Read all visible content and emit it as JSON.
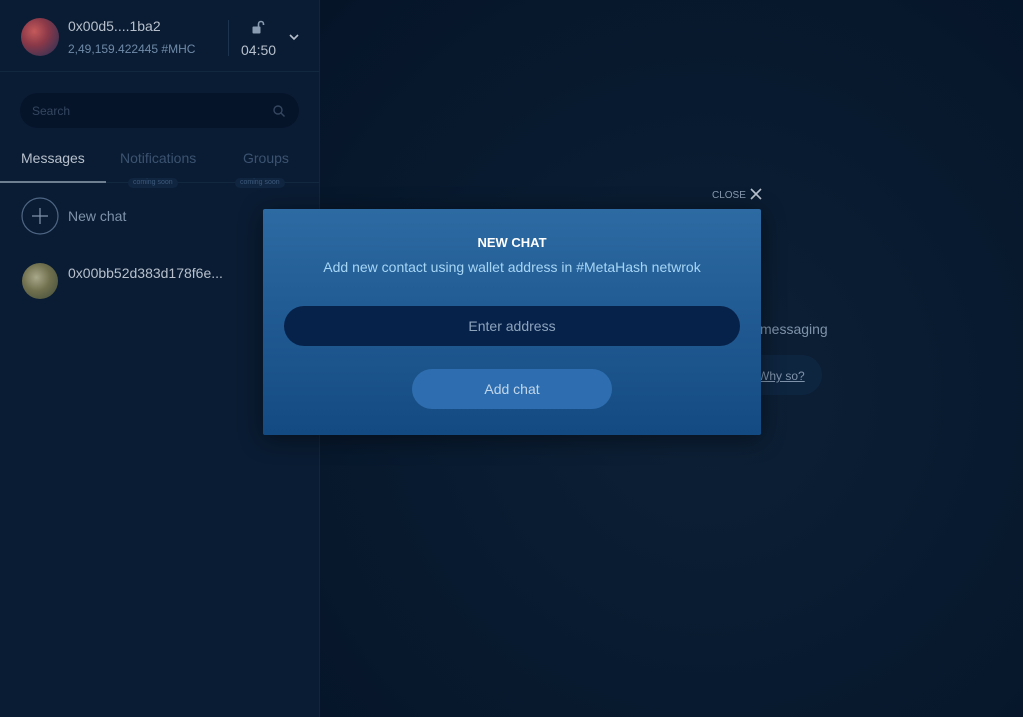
{
  "profile": {
    "address": "0x00d5....1ba2",
    "balance": "2,49,159.422445 #MHC",
    "time": "04:50"
  },
  "search": {
    "placeholder": "Search"
  },
  "tabs": [
    {
      "label": "Messages",
      "active": true
    },
    {
      "label": "Notifications",
      "badge": "coming soon"
    },
    {
      "label": "Groups",
      "badge": "coming soon"
    }
  ],
  "sidebar": {
    "new_chat_label": "New chat",
    "chats": [
      {
        "name": "0x00bb52d383d178f6e..."
      }
    ]
  },
  "main": {
    "partial_text": "messaging",
    "why_link": "Why so?",
    "close_label": "CLOSE"
  },
  "modal": {
    "title": "NEW CHAT",
    "subtitle": "Add new contact using wallet address in #MetaHash netwrok",
    "input_placeholder": "Enter address",
    "button_label": "Add chat"
  },
  "colors": {
    "sidebar_bg": "#0a1c33",
    "main_bg": "#081a2f",
    "modal_bg": "#1f5890",
    "accent": "#2e6eb0"
  }
}
